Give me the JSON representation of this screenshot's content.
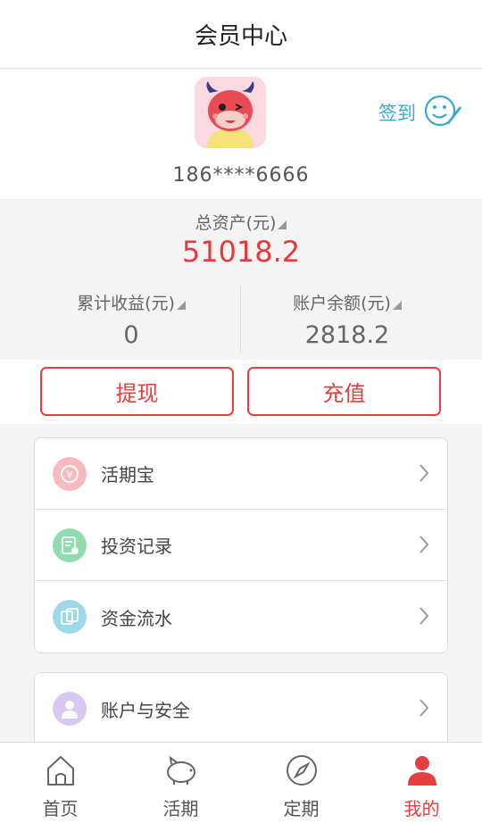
{
  "header": {
    "title": "会员中心"
  },
  "profile": {
    "phone": "186****6666",
    "checkin_label": "签到"
  },
  "assets": {
    "total_label": "总资产(元)",
    "total_value": "51018.2",
    "earnings_label": "累计收益(元)",
    "earnings_value": "0",
    "balance_label": "账户余额(元)",
    "balance_value": "2818.2"
  },
  "actions": {
    "withdraw": "提现",
    "recharge": "充值"
  },
  "menu": [
    {
      "label": "活期宝",
      "icon": "current-treasure-icon",
      "color": "#f8b9bf"
    },
    {
      "label": "投资记录",
      "icon": "investment-record-icon",
      "color": "#8fdcae"
    },
    {
      "label": "资金流水",
      "icon": "fund-flow-icon",
      "color": "#9ed9ea"
    }
  ],
  "menu2": [
    {
      "label": "账户与安全",
      "icon": "account-security-icon",
      "color": "#d8c9f3"
    }
  ],
  "tabs": [
    {
      "label": "首页",
      "icon": "home-icon"
    },
    {
      "label": "活期",
      "icon": "piggy-bank-icon"
    },
    {
      "label": "定期",
      "icon": "compass-icon"
    },
    {
      "label": "我的",
      "icon": "user-icon",
      "active": true
    }
  ],
  "colors": {
    "accent": "#e53f3f",
    "checkin": "#3aa9d6"
  }
}
